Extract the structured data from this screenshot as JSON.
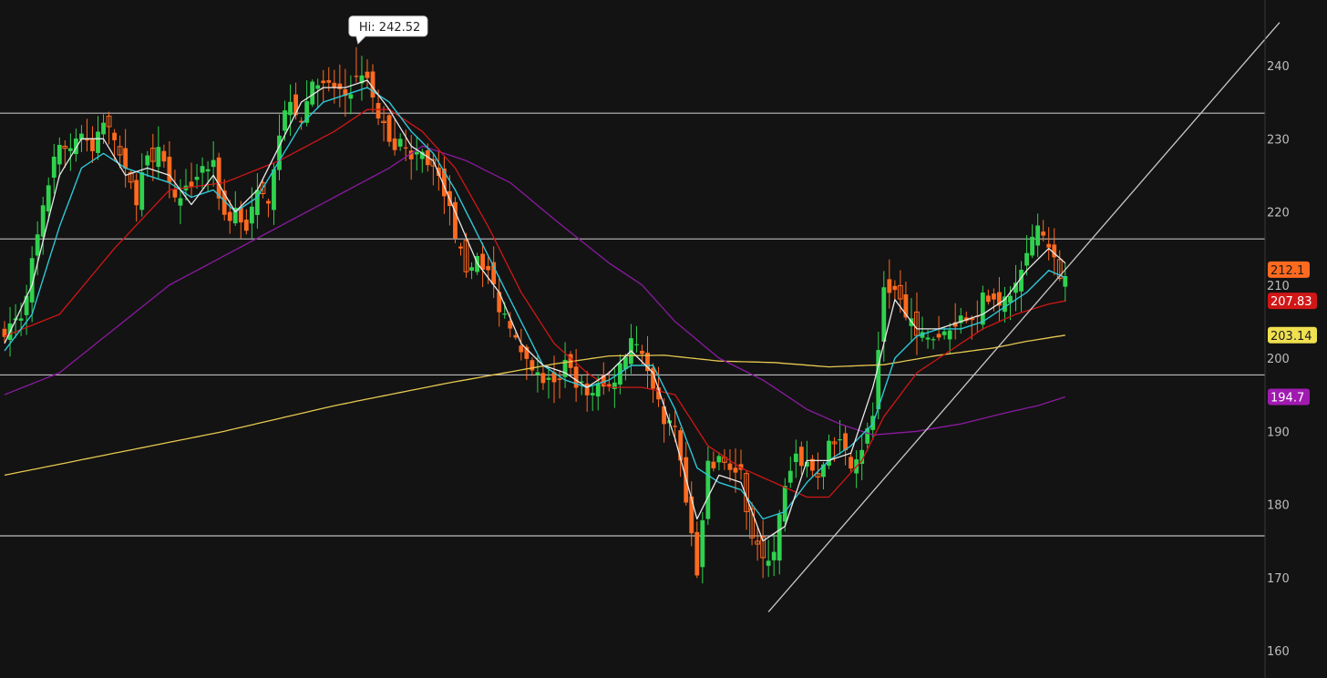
{
  "chart_data": {
    "type": "candlestick",
    "colors": {
      "background": "#131313",
      "up": "#2fd24e",
      "down": "#ff6a1f",
      "sma_fast": "#e8e8e8",
      "sma_med": "#2ec6d6",
      "sma_50": "#d01616",
      "sma_100": "#8a1aa0",
      "sma_200": "#e6c850",
      "hline": "#bdbdbd",
      "trendline": "#c8c8c8",
      "axis_text": "#bdbdbd"
    },
    "ylim": [
      157.5,
      246
    ],
    "y_ticks": [
      {
        "value": 160,
        "label": "160"
      },
      {
        "value": 170,
        "label": "170"
      },
      {
        "value": 180,
        "label": "180"
      },
      {
        "value": 190,
        "label": "190"
      },
      {
        "value": 200,
        "label": "200"
      },
      {
        "value": 210,
        "label": "210"
      },
      {
        "value": 220,
        "label": "220"
      },
      {
        "value": 230,
        "label": "230"
      },
      {
        "value": 240,
        "label": "240"
      }
    ],
    "hi_annotation": {
      "text": "Hi: 242.52",
      "bar": 64,
      "value": 242.52
    },
    "horizontal_lines": [
      233.5,
      216.3,
      197.7,
      175.7
    ],
    "trendline": {
      "from": {
        "bar": 139,
        "value": 165.3
      },
      "to": {
        "bar": 232,
        "value": 245.9
      }
    },
    "price_tags": [
      {
        "label": "212.1",
        "value": 212.1,
        "color": "#ff6a1f",
        "text_color": "#1a1a1a"
      },
      {
        "label": "207.83",
        "value": 207.83,
        "color": "#d01616",
        "text_color": "#ffffff"
      },
      {
        "label": "203.14",
        "value": 203.14,
        "color": "#f0e050",
        "text_color": "#1a1a1a"
      },
      {
        "label": "194.7",
        "value": 194.7,
        "color": "#a01ab0",
        "text_color": "#ffffff"
      }
    ],
    "close_anchors": [
      [
        0,
        204
      ],
      [
        3,
        206
      ],
      [
        5,
        213
      ],
      [
        7,
        220
      ],
      [
        9,
        228
      ],
      [
        12,
        229
      ],
      [
        14,
        231
      ],
      [
        16,
        228
      ],
      [
        18,
        232
      ],
      [
        20,
        230
      ],
      [
        22,
        225
      ],
      [
        24,
        222
      ],
      [
        26,
        228
      ],
      [
        28,
        228
      ],
      [
        30,
        225
      ],
      [
        32,
        221
      ],
      [
        34,
        224
      ],
      [
        36,
        226
      ],
      [
        38,
        226
      ],
      [
        40,
        219
      ],
      [
        42,
        220
      ],
      [
        44,
        218
      ],
      [
        46,
        222
      ],
      [
        48,
        222
      ],
      [
        50,
        231
      ],
      [
        52,
        236
      ],
      [
        54,
        232
      ],
      [
        56,
        238
      ],
      [
        58,
        237
      ],
      [
        60,
        237
      ],
      [
        62,
        236
      ],
      [
        64,
        238
      ],
      [
        66,
        238
      ],
      [
        68,
        233
      ],
      [
        70,
        230
      ],
      [
        72,
        229
      ],
      [
        74,
        228
      ],
      [
        76,
        228
      ],
      [
        78,
        226
      ],
      [
        80,
        223
      ],
      [
        82,
        217
      ],
      [
        84,
        211
      ],
      [
        86,
        214
      ],
      [
        88,
        212
      ],
      [
        90,
        207
      ],
      [
        92,
        205
      ],
      [
        94,
        200
      ],
      [
        96,
        198
      ],
      [
        98,
        197
      ],
      [
        100,
        196
      ],
      [
        102,
        199
      ],
      [
        104,
        197
      ],
      [
        106,
        195
      ],
      [
        108,
        196
      ],
      [
        110,
        196
      ],
      [
        112,
        199
      ],
      [
        114,
        203
      ],
      [
        116,
        201
      ],
      [
        118,
        195
      ],
      [
        120,
        192
      ],
      [
        122,
        190
      ],
      [
        124,
        180
      ],
      [
        126,
        170
      ],
      [
        128,
        185
      ],
      [
        130,
        186
      ],
      [
        132,
        185
      ],
      [
        134,
        184
      ],
      [
        136,
        176
      ],
      [
        138,
        172
      ],
      [
        140,
        174
      ],
      [
        142,
        182
      ],
      [
        144,
        186
      ],
      [
        146,
        186
      ],
      [
        148,
        183
      ],
      [
        150,
        188
      ],
      [
        152,
        188
      ],
      [
        154,
        186
      ],
      [
        156,
        188
      ],
      [
        158,
        192
      ],
      [
        160,
        210
      ],
      [
        162,
        209
      ],
      [
        164,
        206
      ],
      [
        166,
        203
      ],
      [
        168,
        203
      ],
      [
        170,
        203
      ],
      [
        172,
        204
      ],
      [
        174,
        206
      ],
      [
        176,
        205
      ],
      [
        178,
        208
      ],
      [
        180,
        208
      ],
      [
        182,
        208
      ],
      [
        184,
        210
      ],
      [
        186,
        214
      ],
      [
        188,
        218
      ],
      [
        190,
        216
      ],
      [
        192,
        210
      ],
      [
        193,
        212.1
      ]
    ],
    "sma_fast_anchors": [
      [
        0,
        202
      ],
      [
        5,
        210
      ],
      [
        10,
        225
      ],
      [
        14,
        230
      ],
      [
        18,
        230
      ],
      [
        22,
        225
      ],
      [
        26,
        226
      ],
      [
        30,
        225
      ],
      [
        34,
        221
      ],
      [
        38,
        225
      ],
      [
        42,
        220
      ],
      [
        46,
        223
      ],
      [
        50,
        229
      ],
      [
        54,
        235
      ],
      [
        58,
        237
      ],
      [
        62,
        237
      ],
      [
        66,
        238
      ],
      [
        70,
        234
      ],
      [
        74,
        229
      ],
      [
        78,
        227
      ],
      [
        82,
        220
      ],
      [
        86,
        213
      ],
      [
        90,
        209
      ],
      [
        94,
        202
      ],
      [
        98,
        199
      ],
      [
        102,
        198
      ],
      [
        106,
        196
      ],
      [
        110,
        198
      ],
      [
        114,
        201
      ],
      [
        118,
        198
      ],
      [
        122,
        189
      ],
      [
        126,
        178
      ],
      [
        130,
        184
      ],
      [
        134,
        183
      ],
      [
        138,
        175
      ],
      [
        142,
        177
      ],
      [
        146,
        186
      ],
      [
        150,
        186
      ],
      [
        154,
        187
      ],
      [
        158,
        196
      ],
      [
        162,
        208
      ],
      [
        166,
        204
      ],
      [
        170,
        204
      ],
      [
        174,
        205
      ],
      [
        178,
        206
      ],
      [
        182,
        208
      ],
      [
        186,
        212
      ],
      [
        190,
        215
      ],
      [
        193,
        213
      ]
    ],
    "sma_med_anchors": [
      [
        0,
        201
      ],
      [
        5,
        206
      ],
      [
        10,
        218
      ],
      [
        14,
        226
      ],
      [
        18,
        228
      ],
      [
        22,
        226
      ],
      [
        26,
        225
      ],
      [
        30,
        224
      ],
      [
        34,
        222
      ],
      [
        38,
        223
      ],
      [
        42,
        220
      ],
      [
        46,
        222
      ],
      [
        50,
        227
      ],
      [
        54,
        232
      ],
      [
        58,
        235
      ],
      [
        62,
        236
      ],
      [
        66,
        237
      ],
      [
        70,
        235
      ],
      [
        74,
        231
      ],
      [
        78,
        228
      ],
      [
        82,
        223
      ],
      [
        86,
        217
      ],
      [
        90,
        211
      ],
      [
        94,
        205
      ],
      [
        98,
        199
      ],
      [
        102,
        197
      ],
      [
        106,
        196
      ],
      [
        110,
        197
      ],
      [
        114,
        199
      ],
      [
        118,
        199
      ],
      [
        122,
        193
      ],
      [
        126,
        185
      ],
      [
        130,
        183
      ],
      [
        134,
        182
      ],
      [
        138,
        178
      ],
      [
        142,
        179
      ],
      [
        146,
        183
      ],
      [
        150,
        186
      ],
      [
        154,
        188
      ],
      [
        158,
        191
      ],
      [
        162,
        200
      ],
      [
        166,
        203
      ],
      [
        170,
        204
      ],
      [
        174,
        204
      ],
      [
        178,
        205
      ],
      [
        182,
        207
      ],
      [
        186,
        209
      ],
      [
        190,
        212
      ],
      [
        193,
        211
      ]
    ],
    "sma_50_anchors": [
      [
        0,
        203
      ],
      [
        10,
        206
      ],
      [
        20,
        215
      ],
      [
        30,
        223
      ],
      [
        40,
        224
      ],
      [
        50,
        227
      ],
      [
        60,
        231
      ],
      [
        66,
        234
      ],
      [
        70,
        234
      ],
      [
        76,
        231
      ],
      [
        82,
        226
      ],
      [
        88,
        218
      ],
      [
        94,
        209
      ],
      [
        100,
        202
      ],
      [
        106,
        198
      ],
      [
        110,
        196
      ],
      [
        116,
        196
      ],
      [
        122,
        195
      ],
      [
        128,
        188
      ],
      [
        134,
        185
      ],
      [
        140,
        183
      ],
      [
        146,
        181
      ],
      [
        150,
        181
      ],
      [
        156,
        186
      ],
      [
        160,
        192
      ],
      [
        166,
        198
      ],
      [
        172,
        201
      ],
      [
        178,
        204
      ],
      [
        184,
        206
      ],
      [
        190,
        207.4
      ],
      [
        193,
        207.83
      ]
    ],
    "sma_100_anchors": [
      [
        0,
        195
      ],
      [
        10,
        198
      ],
      [
        20,
        204
      ],
      [
        30,
        210
      ],
      [
        40,
        214
      ],
      [
        50,
        218
      ],
      [
        60,
        222
      ],
      [
        70,
        226
      ],
      [
        76,
        229
      ],
      [
        84,
        227
      ],
      [
        92,
        224
      ],
      [
        100,
        219
      ],
      [
        110,
        213
      ],
      [
        116,
        210
      ],
      [
        122,
        205
      ],
      [
        130,
        200
      ],
      [
        138,
        197
      ],
      [
        146,
        193
      ],
      [
        152,
        191
      ],
      [
        158,
        189.5
      ],
      [
        166,
        190
      ],
      [
        174,
        191
      ],
      [
        182,
        192.5
      ],
      [
        188,
        193.5
      ],
      [
        193,
        194.7
      ]
    ],
    "sma_200_anchors": [
      [
        0,
        184
      ],
      [
        20,
        187
      ],
      [
        40,
        190
      ],
      [
        60,
        193.5
      ],
      [
        80,
        196.5
      ],
      [
        100,
        199.2
      ],
      [
        110,
        200.3
      ],
      [
        120,
        200.4
      ],
      [
        130,
        199.6
      ],
      [
        140,
        199.4
      ],
      [
        150,
        198.8
      ],
      [
        160,
        199.1
      ],
      [
        170,
        200.4
      ],
      [
        180,
        201.4
      ],
      [
        186,
        202.3
      ],
      [
        193,
        203.14
      ]
    ]
  }
}
